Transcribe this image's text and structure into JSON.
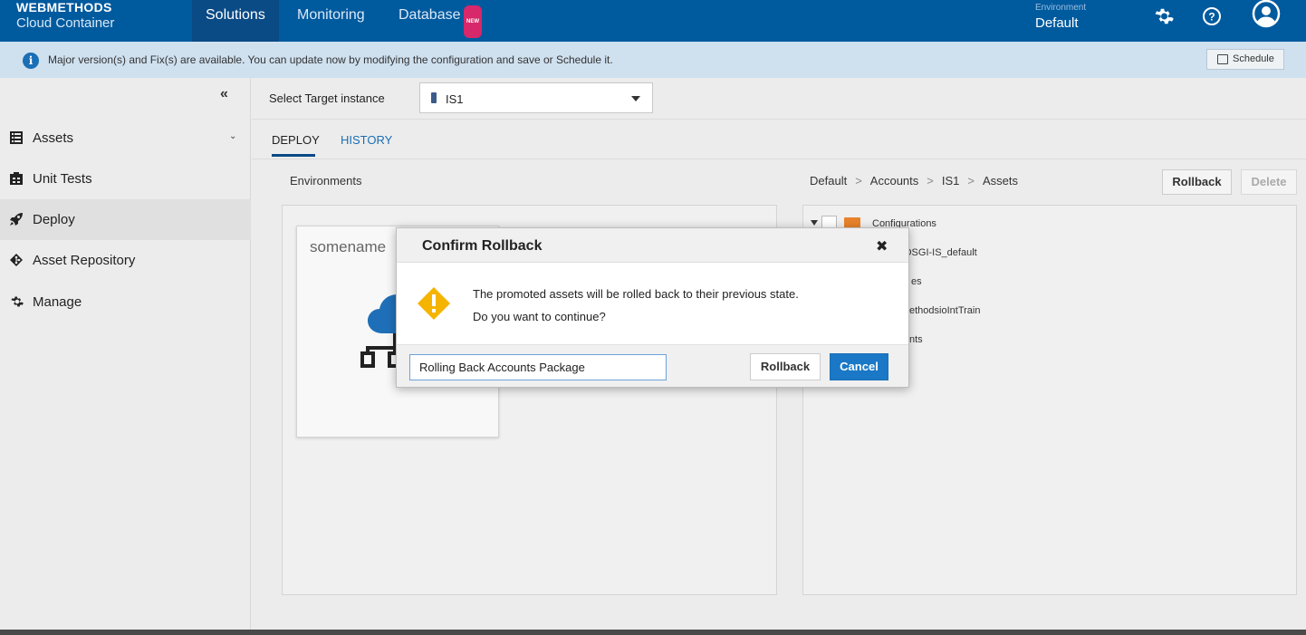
{
  "topbar": {
    "brand_line1": "WEBMETHODS",
    "brand_line2": "Cloud Container",
    "nav": [
      {
        "label": "Solutions",
        "active": true
      },
      {
        "label": "Monitoring",
        "active": false
      },
      {
        "label": "Database",
        "active": false,
        "badge": "NEW"
      }
    ],
    "environment_label": "Environment",
    "environment_value": "Default",
    "icons": [
      "gear-icon",
      "help-icon",
      "user-avatar-icon"
    ]
  },
  "notification": {
    "icon": "info-icon",
    "text": "Major version(s) and Fix(s) are available. You can update now by modifying the configuration and save or Schedule it.",
    "schedule_label": "Schedule"
  },
  "sidebar": {
    "collapse_glyph": "«",
    "items": [
      {
        "label": "Assets",
        "icon": "assets-icon",
        "expandable": true
      },
      {
        "label": "Unit Tests",
        "icon": "unit-tests-icon"
      },
      {
        "label": "Deploy",
        "icon": "rocket-icon",
        "active": true
      },
      {
        "label": "Asset Repository",
        "icon": "repository-icon"
      },
      {
        "label": "Manage",
        "icon": "gear-icon"
      }
    ]
  },
  "main": {
    "target_label": "Select Target instance",
    "target_value": "IS1",
    "tabs": [
      {
        "label": "DEPLOY",
        "active": true
      },
      {
        "label": "HISTORY",
        "active": false
      }
    ],
    "environments_heading": "Environments",
    "breadcrumb": [
      "Default",
      "Accounts",
      "IS1",
      "Assets"
    ],
    "rollback_label": "Rollback",
    "delete_label": "Delete",
    "env_card_name": "somename",
    "tree": [
      "Configurations",
      "OSGI-IS_default",
      "es",
      "ethodsioIntTrain",
      "nts"
    ]
  },
  "modal": {
    "title": "Confirm Rollback",
    "close_glyph": "✖",
    "message_line1": "The promoted assets will be rolled back to their previous state.",
    "message_line2": "Do you want to continue?",
    "comment_value": "Rolling Back Accounts Package",
    "rollback_label": "Rollback",
    "cancel_label": "Cancel"
  },
  "colors": {
    "topbar": "#005a9e",
    "notification": "#cfe0ef",
    "accent": "#1a78c6",
    "warning": "#f5b400",
    "badge": "#d6286a",
    "folder": "#e8832c"
  }
}
